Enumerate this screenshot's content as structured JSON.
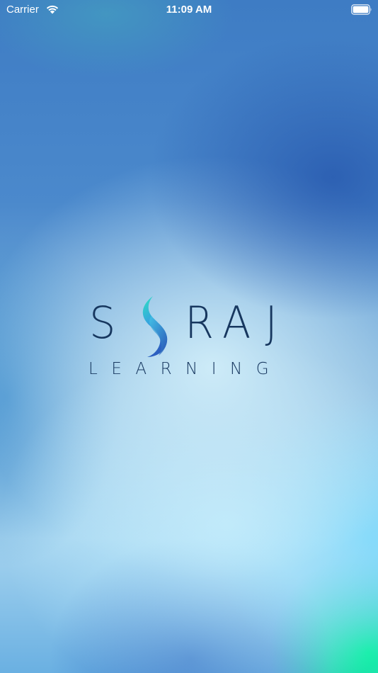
{
  "status_bar": {
    "carrier": "Carrier",
    "time": "11:09 AM",
    "icons": [
      "wifi-icon",
      "battery-icon"
    ]
  },
  "logo": {
    "letters": [
      "S",
      "R",
      "A",
      "J"
    ],
    "mark_icon": "swirl-s-mark-icon",
    "subtitle": "LEARNING"
  },
  "colors": {
    "logo_text": "#17375f",
    "mark_top": "#2ed8c0",
    "mark_bottom": "#2f66c2",
    "status_text": "#ffffff"
  }
}
